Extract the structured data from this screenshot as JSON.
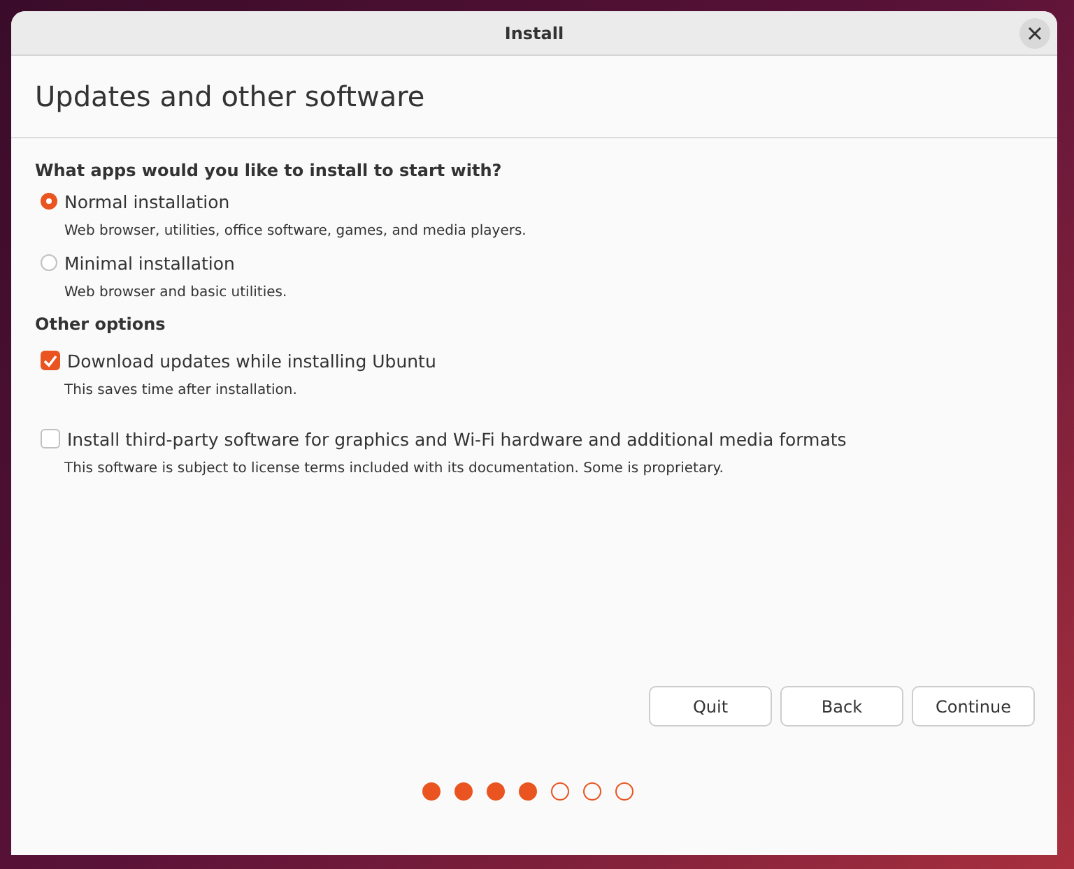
{
  "window": {
    "title": "Install"
  },
  "heading": "Updates and other software",
  "install_type": {
    "question": "What apps would you like to install to start with?",
    "options": [
      {
        "label": "Normal installation",
        "description": "Web browser, utilities, office software, games, and media players.",
        "selected": true
      },
      {
        "label": "Minimal installation",
        "description": "Web browser and basic utilities.",
        "selected": false
      }
    ]
  },
  "other_options": {
    "title": "Other options",
    "options": [
      {
        "label": "Download updates while installing Ubuntu",
        "description": "This saves time after installation.",
        "checked": true
      },
      {
        "label": "Install third-party software for graphics and Wi-Fi hardware and additional media formats",
        "description": "This software is subject to license terms included with its documentation. Some is proprietary.",
        "checked": false
      }
    ]
  },
  "buttons": [
    "Quit",
    "Back",
    "Continue"
  ],
  "progress_steps": [
    {
      "done": true
    },
    {
      "done": true
    },
    {
      "done": true
    },
    {
      "done": true
    },
    {
      "done": false
    },
    {
      "done": false
    },
    {
      "done": false
    }
  ]
}
